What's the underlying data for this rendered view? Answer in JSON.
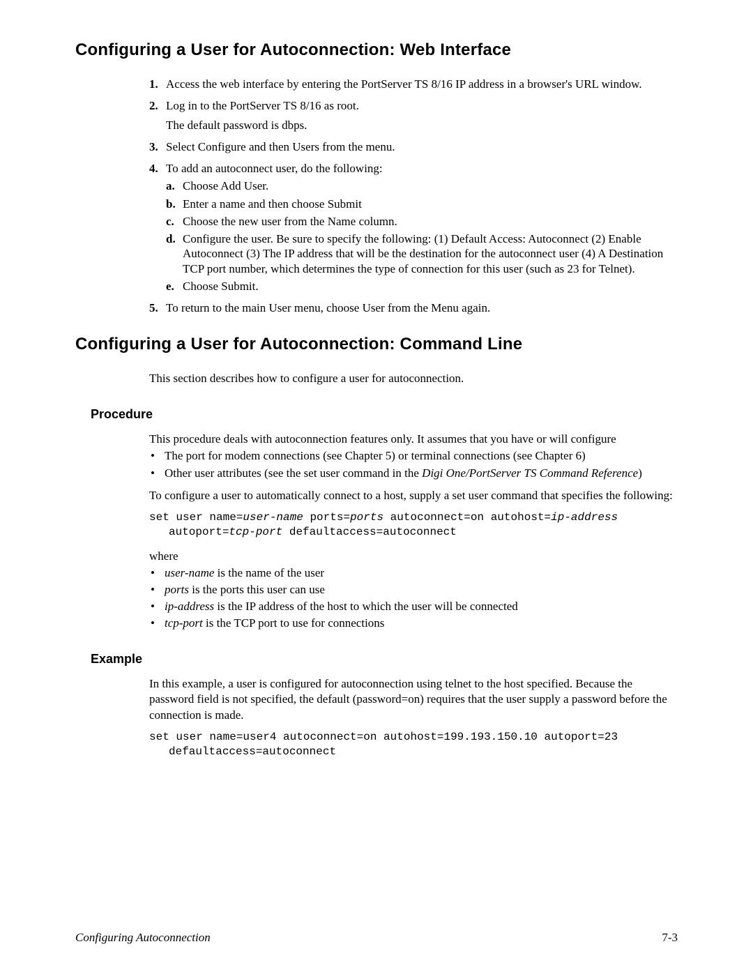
{
  "section1": {
    "title": "Configuring a User for Autoconnection: Web Interface",
    "steps": {
      "s1": "Access the web interface by entering the PortServer TS 8/16 IP address in a browser's URL window.",
      "s2": "Log in to the PortServer TS 8/16 as root.",
      "s2_extra": "The default password is dbps.",
      "s3": "Select Configure and then Users from the menu.",
      "s4": "To add an autoconnect user, do the following:",
      "s4a": "Choose Add User.",
      "s4b": "Enter a name and then choose Submit",
      "s4c": "Choose the new user from the Name column.",
      "s4d": "Configure the user. Be sure to specify the following: (1) Default Access: Autoconnect (2) Enable Autoconnect (3) The IP address that will be the destination for the autoconnect user (4) A Destination TCP port number, which determines the type of connection for this user (such as 23 for Telnet).",
      "s4e": "Choose Submit.",
      "s5": "To return to the main User menu, choose User from the Menu again."
    }
  },
  "section2": {
    "title": "Configuring a User for Autoconnection: Command Line",
    "intro": "This section describes how to configure a user for autoconnection.",
    "procedure_heading": "Procedure",
    "proc_p1": "This procedure deals with autoconnection features only. It assumes that you have or will configure",
    "proc_b1": "The port for modem connections (see Chapter 5) or terminal connections (see Chapter 6)",
    "proc_b2_pre": "Other user attributes (see the set user command in the ",
    "proc_b2_em": "Digi One/PortServer TS Command Reference",
    "proc_b2_post": ")",
    "proc_p2": "To configure a user to automatically connect to a host, supply a set user command that specifies the following:",
    "code1_l1a": "set user name=",
    "code1_l1b": "user-name",
    "code1_l1c": " ports=",
    "code1_l1d": "ports",
    "code1_l1e": " autoconnect=on autohost=",
    "code1_l1f": "ip-address",
    "code1_l2a": "autoport=",
    "code1_l2b": "tcp-port",
    "code1_l2c": " defaultaccess=autoconnect",
    "where": "where",
    "wb1_em": "user-name",
    "wb1_rest": " is the name of the user",
    "wb2_em": "ports",
    "wb2_rest": " is the ports this user can use",
    "wb3_em": "ip-address",
    "wb3_rest": " is the IP address of the host to which the user will be connected",
    "wb4_em": "tcp-port",
    "wb4_rest": " is the TCP port to use for connections",
    "example_heading": "Example",
    "ex_p": "In this example, a user is configured for autoconnection using telnet to the host specified. Because the password field is not specified, the default (password=on) requires that the user supply a password before the connection is made.",
    "code2_l1": "set user name=user4 autoconnect=on autohost=199.193.150.10 autoport=23",
    "code2_l2": "defaultaccess=autoconnect"
  },
  "footer": {
    "left": "Configuring Autoconnection",
    "right": "7-3"
  },
  "markers": {
    "n1": "1.",
    "n2": "2.",
    "n3": "3.",
    "n4": "4.",
    "n5": "5.",
    "la": "a.",
    "lb": "b.",
    "lc": "c.",
    "ld": "d.",
    "le": "e."
  }
}
